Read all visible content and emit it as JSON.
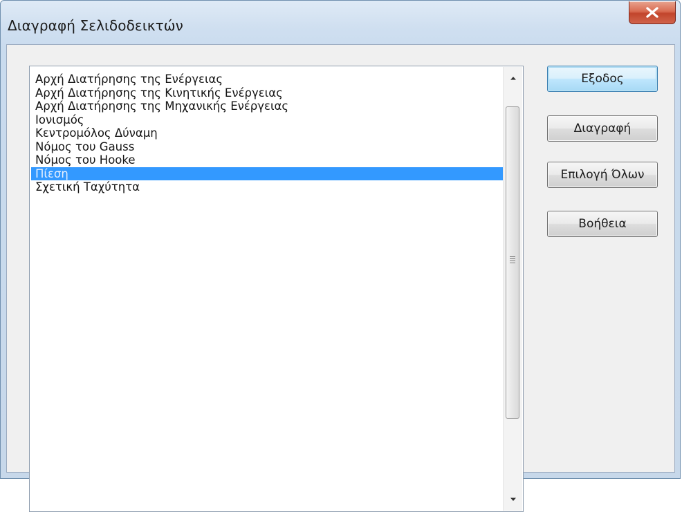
{
  "window": {
    "title": "Διαγραφή Σελιδοδεικτών",
    "close_glyph": "✕"
  },
  "list": {
    "items": [
      "Αρχή Διατήρησης της Ενέργειας",
      "Αρχή Διατήρησης της Κινητικής Ενέργειας",
      "Αρχή Διατήρησης της Μηχανικής Ενέργειας",
      "Ιονισμός",
      "Κεντρομόλος Δύναμη",
      "Νόμος του Gauss",
      "Νόμος του Hooke",
      "Πίεση",
      "Σχετική Ταχύτητα"
    ],
    "selected_item": "Πίεση",
    "selected_index": 7
  },
  "buttons": {
    "exit": "Εξοδος",
    "delete": "Διαγραφή",
    "select_all": "Επιλογή Όλων",
    "help": "Βοήθεια"
  },
  "colors": {
    "selection": "#3399ff",
    "close_button": "#c9513a"
  }
}
